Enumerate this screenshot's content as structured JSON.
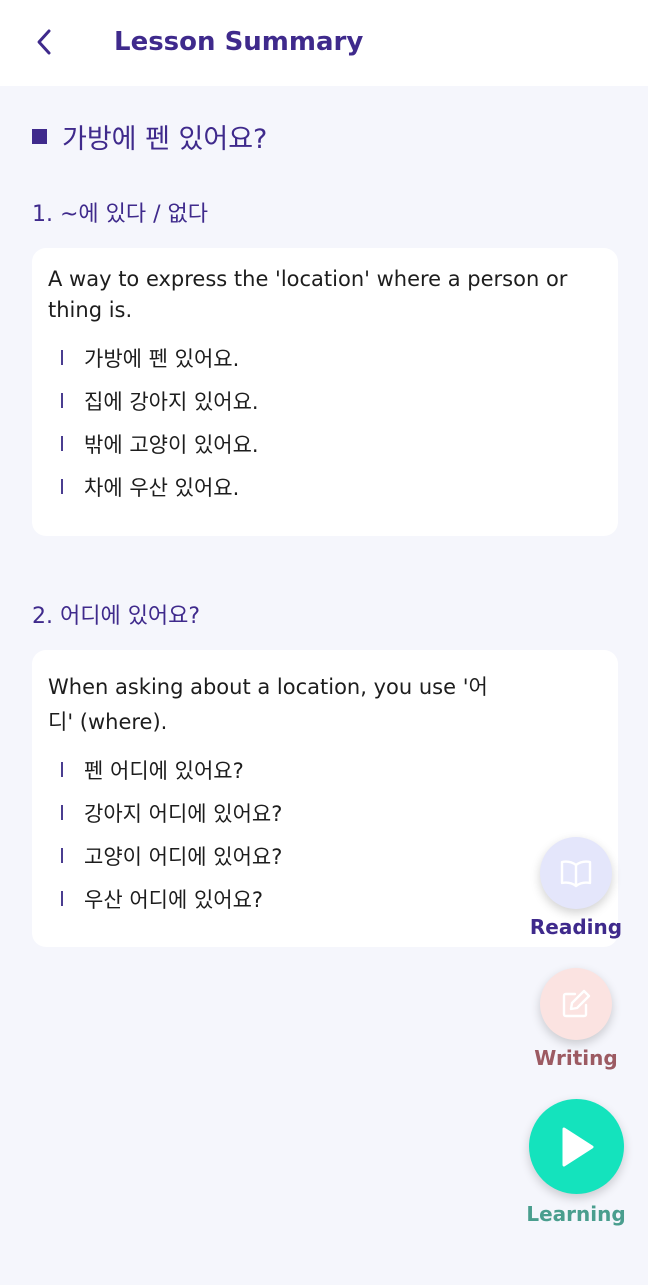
{
  "header": {
    "title": "Lesson Summary",
    "back_icon": "chevron-left-icon"
  },
  "lesson": {
    "title": "가방에 펜 있어요?"
  },
  "sections": [
    {
      "heading": "1. ~에 있다 / 없다",
      "description_line1": "A way to express the 'location' where a person or",
      "description_line2": "thing is.",
      "examples": [
        "가방에 펜 있어요.",
        "집에 강아지 있어요.",
        "밖에 고양이 있어요.",
        "차에 우산 있어요."
      ]
    },
    {
      "heading": "2. 어디에 있어요?",
      "description_line1": "When asking about a location, you use '어",
      "description_line2": "디' (where).",
      "examples": [
        "펜 어디에 있어요?",
        "강아지 어디에 있어요?",
        "고양이 어디에 있어요?",
        "우산 어디에 있어요?"
      ]
    }
  ],
  "actions": {
    "reading": {
      "label": "Reading",
      "icon": "book-open-icon",
      "color": "#3f2a8c",
      "bg": "#e4e6fb"
    },
    "writing": {
      "label": "Writing",
      "icon": "edit-icon",
      "color": "#9c5a62",
      "bg": "#fbe3e1"
    },
    "learning": {
      "label": "Learning",
      "icon": "play-icon",
      "color": "#4a9e8e",
      "bg": "#14e3bd"
    }
  }
}
